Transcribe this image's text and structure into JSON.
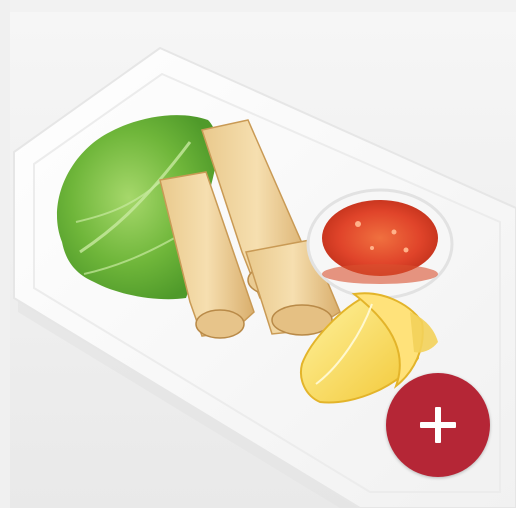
{
  "product_card": {
    "image_icon": "spring-rolls-with-sweet-chili-sauce-photo",
    "add_button": {
      "icon": "plus-icon",
      "color": "#b52636"
    }
  }
}
